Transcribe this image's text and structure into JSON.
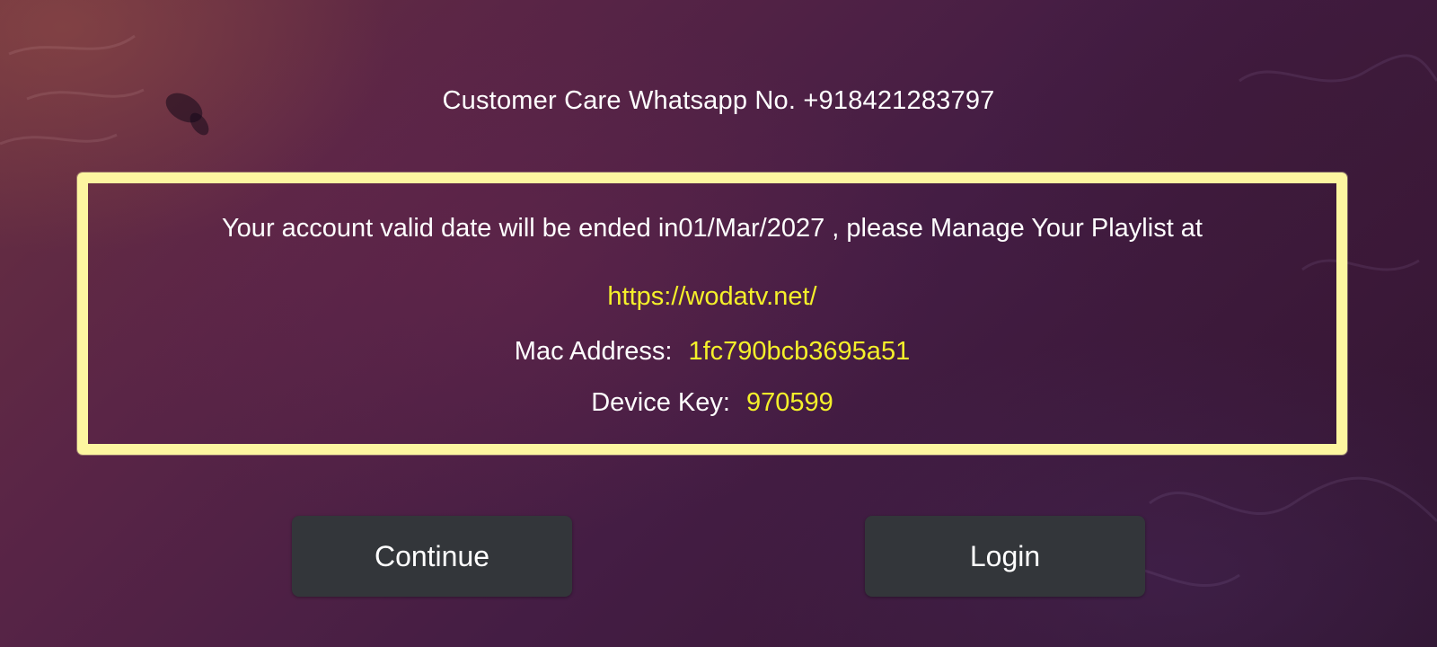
{
  "header": {
    "whatsapp_text": "Customer Care Whatsapp No. +918421283797"
  },
  "panel": {
    "validity_text": "Your account valid date will be ended in01/Mar/2027 , please Manage Your Playlist at",
    "manage_url": "https://wodatv.net/",
    "mac_label": "Mac Address:",
    "mac_value": "1fc790bcb3695a51",
    "device_key_label": "Device Key:",
    "device_key_value": "970599"
  },
  "buttons": {
    "continue_label": "Continue",
    "login_label": "Login"
  },
  "colors": {
    "panel_border": "#fdf6a0",
    "highlight_text": "#f4f02a",
    "button_bg": "#33363a"
  }
}
